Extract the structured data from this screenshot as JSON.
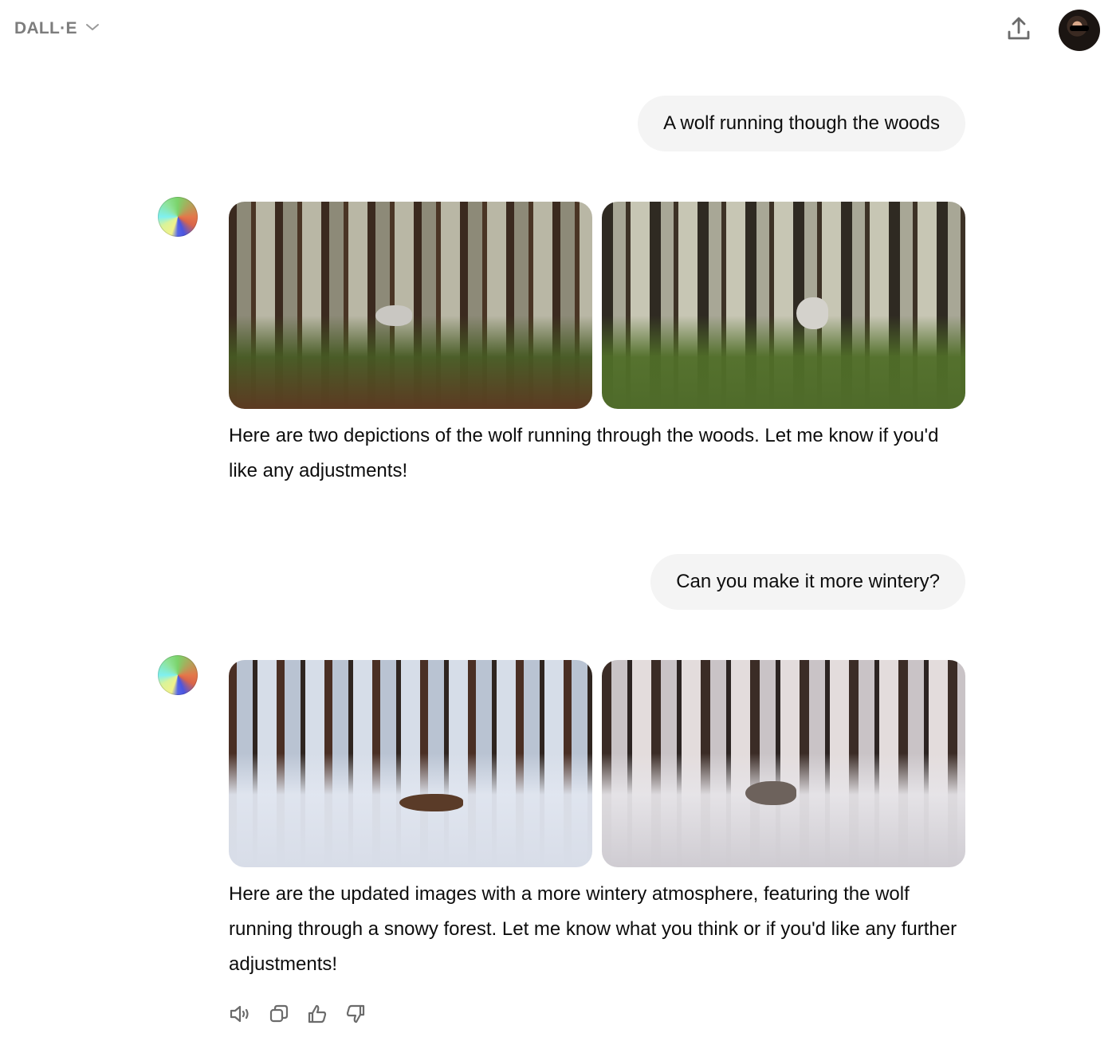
{
  "header": {
    "model_name": "DALL·E",
    "model_dropdown_icon": "chevron-down-icon",
    "share_icon": "share-upload-icon",
    "avatar": "user-avatar"
  },
  "conversation": [
    {
      "role": "user",
      "text": "A wolf running though the woods"
    },
    {
      "role": "assistant",
      "icon": "dalle-color-wheel-icon",
      "images": [
        {
          "alt": "Wolf running through a misty pine forest with mossy ground"
        },
        {
          "alt": "Wolf running toward viewer through sunlit pine forest"
        }
      ],
      "text": "Here are two depictions of the wolf running through the woods. Let me know if you'd like any adjustments!"
    },
    {
      "role": "user",
      "text": "Can you make it more wintery?"
    },
    {
      "role": "assistant",
      "icon": "dalle-color-wheel-icon",
      "images": [
        {
          "alt": "Wolf leaping through snowy forest with frosted young firs"
        },
        {
          "alt": "Wolf running across snow in sunlit winter pine forest"
        }
      ],
      "text": "Here are the updated images with a more wintery atmosphere, featuring the wolf running through a snowy forest. Let me know what you think or if you'd like any further adjustments!"
    }
  ],
  "message_actions": [
    {
      "name": "read-aloud",
      "icon": "speaker-icon"
    },
    {
      "name": "copy",
      "icon": "copy-icon"
    },
    {
      "name": "good-response",
      "icon": "thumbs-up-icon"
    },
    {
      "name": "bad-response",
      "icon": "thumbs-down-icon"
    }
  ],
  "colors": {
    "user_bubble": "#f4f4f4",
    "muted_text": "#7d7d7d",
    "text": "#0d0d0d"
  }
}
